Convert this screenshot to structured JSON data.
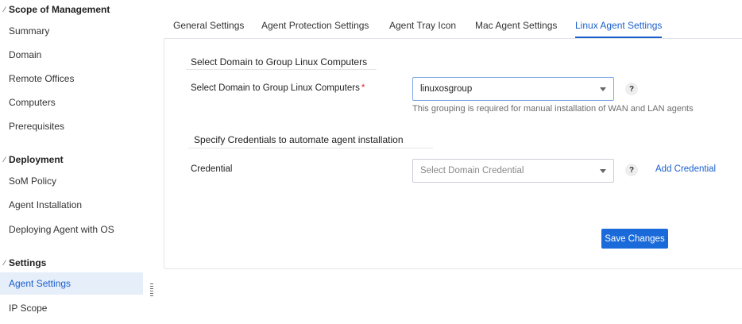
{
  "sidebar": {
    "sections": [
      {
        "title": "Scope of Management",
        "items": [
          "Summary",
          "Domain",
          "Remote Offices",
          "Computers",
          "Prerequisites"
        ]
      },
      {
        "title": "Deployment",
        "items": [
          "SoM Policy",
          "Agent Installation",
          "Deploying Agent with OS"
        ]
      },
      {
        "title": "Settings",
        "items": [
          "Agent Settings",
          "IP Scope"
        ]
      }
    ],
    "active_item": "Agent Settings"
  },
  "tabs": {
    "items": [
      "General Settings",
      "Agent Protection Settings",
      "Agent Tray Icon",
      "Mac Agent Settings",
      "Linux Agent Settings"
    ],
    "active": "Linux Agent Settings"
  },
  "form": {
    "group_section_title": "Select Domain to Group Linux Computers",
    "group_label": "Select Domain to Group Linux Computers",
    "required_mark": "*",
    "group_value": "linuxosgroup",
    "group_hint": "This grouping is required for manual installation of WAN and LAN agents",
    "cred_section_title": "Specify Credentials to automate agent installation",
    "cred_label": "Credential",
    "cred_placeholder": "Select Domain Credential",
    "add_credential": "Add Credential",
    "help_glyph": "?",
    "save_button": "Save Changes"
  },
  "colors": {
    "accent": "#1a5fcd",
    "button": "#1a6ad9",
    "active_bg": "#e6eef9",
    "required": "#d9302c"
  },
  "icons": {
    "section_toggle": "chevron-icon",
    "dropdown": "caret-down-icon",
    "help": "help-icon",
    "resize": "resize-handle-icon"
  }
}
